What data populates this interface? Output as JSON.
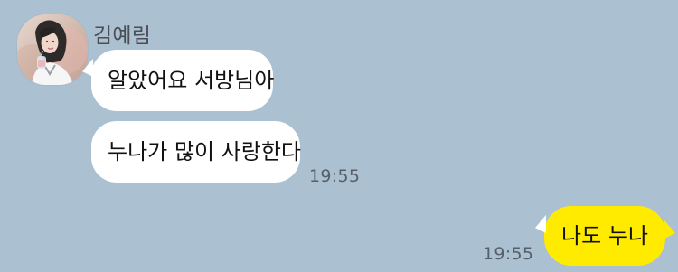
{
  "conversation": {
    "sender": {
      "name": "김예림",
      "avatar_icon": "profile-photo-icon"
    },
    "messages": [
      {
        "direction": "incoming",
        "text": "알았어요 서방님아",
        "time": ""
      },
      {
        "direction": "incoming",
        "text": "누나가 많이 사랑한다",
        "time": "19:55"
      },
      {
        "direction": "outgoing",
        "text": "나도 누나",
        "time": "19:55"
      }
    ]
  },
  "colors": {
    "background": "#abc1d1",
    "incoming_bubble": "#ffffff",
    "outgoing_bubble": "#ffeb00",
    "time_text": "#55606b",
    "name_text": "#4b4f54"
  }
}
